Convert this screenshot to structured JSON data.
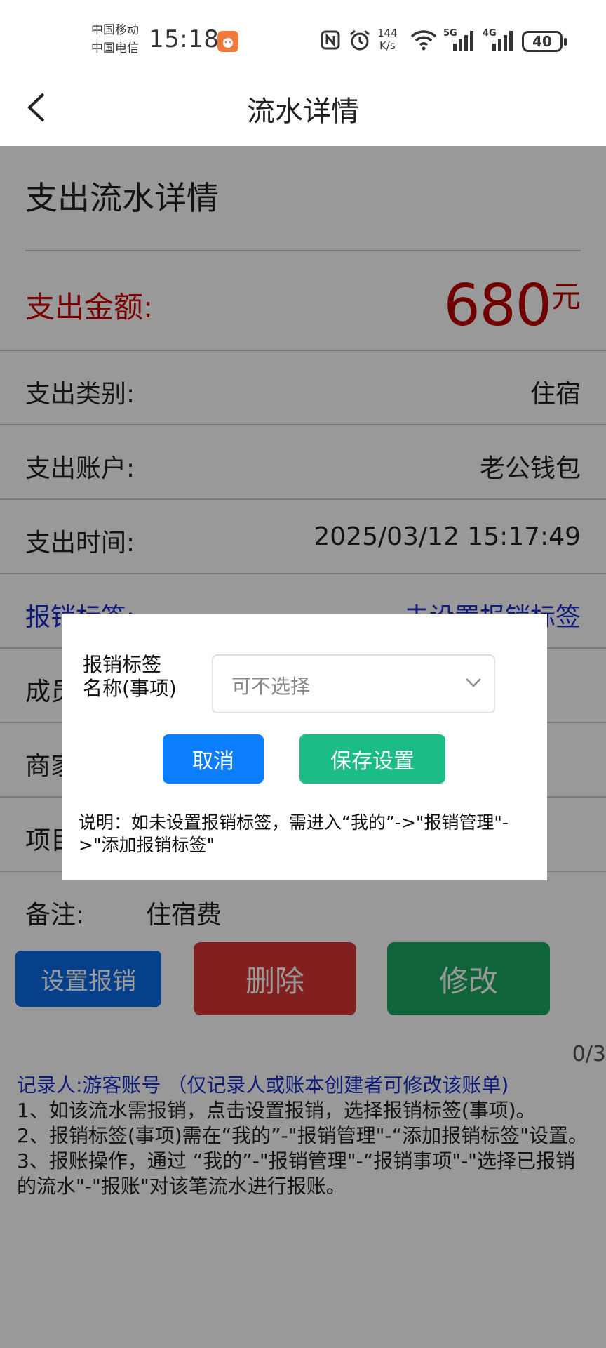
{
  "status_bar": {
    "carrier1": "中国移动",
    "carrier2": "中国电信",
    "time": "15:18",
    "net_speed_value": "144",
    "net_speed_unit": "K/s",
    "signal1": "5G",
    "signal2": "4G",
    "battery": "40"
  },
  "header": {
    "title": "流水详情"
  },
  "detail": {
    "section_title": "支出流水详情",
    "amount_label": "支出金额:",
    "amount_value": "680",
    "amount_unit": "元",
    "category_label": "支出类别:",
    "category_value": "住宿",
    "account_label": "支出账户:",
    "account_value": "老公钱包",
    "time_label": "支出时间:",
    "time_value": "2025/03/12 15:17:49",
    "tag_label": "报销标签:",
    "tag_value": "去设置报销标签",
    "member_label": "成员:",
    "merchant_label": "商家:",
    "project_label": "项目:",
    "remark_label": "备注:",
    "remark_value": "住宿费"
  },
  "actions": {
    "set_reimburse": "设置报销",
    "delete": "删除",
    "edit": "修改"
  },
  "counter": "0/3",
  "notes": {
    "recorder": "记录人:游客账号 （仅记录人或账本创建者可修改该账单)",
    "line1": "1、如该流水需报销，点击设置报销，选择报销标签(事项)。",
    "line2": "2、报销标签(事项)需在“我的”-\"报销管理\"-“添加报销标签\"设置。",
    "line3": "3、报账操作，通过 “我的”-\"报销管理\"-“报销事项\"-\"选择已报销的流水\"-\"报账\"对该笔流水进行报账。"
  },
  "dialog": {
    "label_line1": "报销标签",
    "label_line2": "名称(事项)",
    "select_placeholder": "可不选择",
    "cancel": "取消",
    "save": "保存设置",
    "note": "说明：如未设置报销标签，需进入“我的”->\"报销管理\"->\"添加报销标签\""
  },
  "colors": {
    "amount": "#b00000",
    "blue_link": "#1a2ecc",
    "btn_set": "#0a6ae6",
    "btn_delete": "#d93636",
    "btn_edit": "#1aa860",
    "dlg_cancel": "#0b7dff",
    "dlg_save": "#1bbd84"
  }
}
